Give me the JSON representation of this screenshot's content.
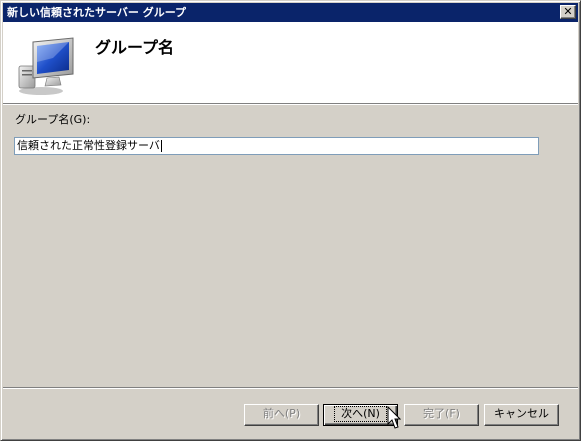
{
  "window": {
    "title": "新しい信頼されたサーバー グループ",
    "close_glyph": "✕"
  },
  "header": {
    "heading": "グループ名",
    "icon": "monitor-icon"
  },
  "form": {
    "group_name_label": "グループ名(G):",
    "group_name_value": "信頼された正常性登録サーバ"
  },
  "buttons": {
    "back_label": "前へ(P)",
    "next_label": "次へ(N)",
    "finish_label": "完了(F)",
    "cancel_label": "キャンセル"
  },
  "colors": {
    "titlebar": "#0a246a",
    "dialog_face": "#d4d0c8",
    "header_bg": "#ffffff"
  }
}
